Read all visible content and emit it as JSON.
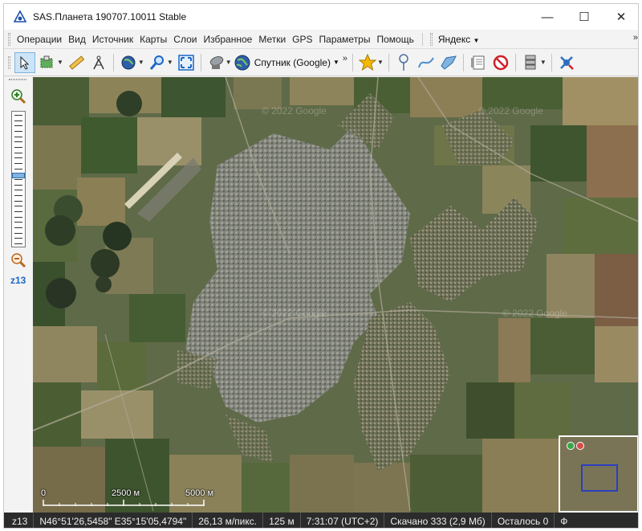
{
  "window": {
    "title": "SAS.Планета 190707.10011 Stable",
    "controls": {
      "minimize": "—",
      "maximize": "☐",
      "close": "✕"
    }
  },
  "menu": {
    "items": [
      "Операции",
      "Вид",
      "Источник",
      "Карты",
      "Слои",
      "Избранное",
      "Метки",
      "GPS",
      "Параметры",
      "Помощь"
    ],
    "provider": "Яндекс",
    "overflow": "»"
  },
  "toolbar": {
    "map_source": "Спутник (Google)",
    "overflow": "»",
    "icons": [
      "pointer-icon",
      "select-area-icon",
      "ruler-icon",
      "compass-icon",
      "globe-icon",
      "search-icon",
      "fullscreen-icon",
      "satellite-dish-icon",
      "globe-icon",
      "star-icon",
      "placemark-icon",
      "polyline-icon",
      "polygon-icon",
      "marks-list-icon",
      "no-entry-icon",
      "database-icon",
      "gps-icon"
    ]
  },
  "zoom": {
    "level": "z13",
    "level_fraction": 0.46
  },
  "map": {
    "watermarks": [
      "© 2022 Google",
      "© 2022 Google",
      "© 2022 Google",
      "© 2022 Google"
    ],
    "scale": {
      "labels": [
        "0",
        "2500 м",
        "5000 м"
      ]
    }
  },
  "status": {
    "zoom": "z13",
    "coords": "N46°51'26,5458\" E35°15'05,4794\"",
    "resolution": "26,13 м/пикс.",
    "elevation": "125 м",
    "time": "7:31:07 (UTC+2)",
    "downloaded": "Скачано 333 (2,9 Мб)",
    "remaining": "Осталось 0",
    "extra": "Ф"
  },
  "colors": {
    "map_base": "#5f6a48",
    "urban": "#8a8c86",
    "field_light": "#8c8358",
    "field_dark": "#3d5530",
    "accent_blue": "#1c67c6",
    "status_bg": "#2b2b2b"
  }
}
